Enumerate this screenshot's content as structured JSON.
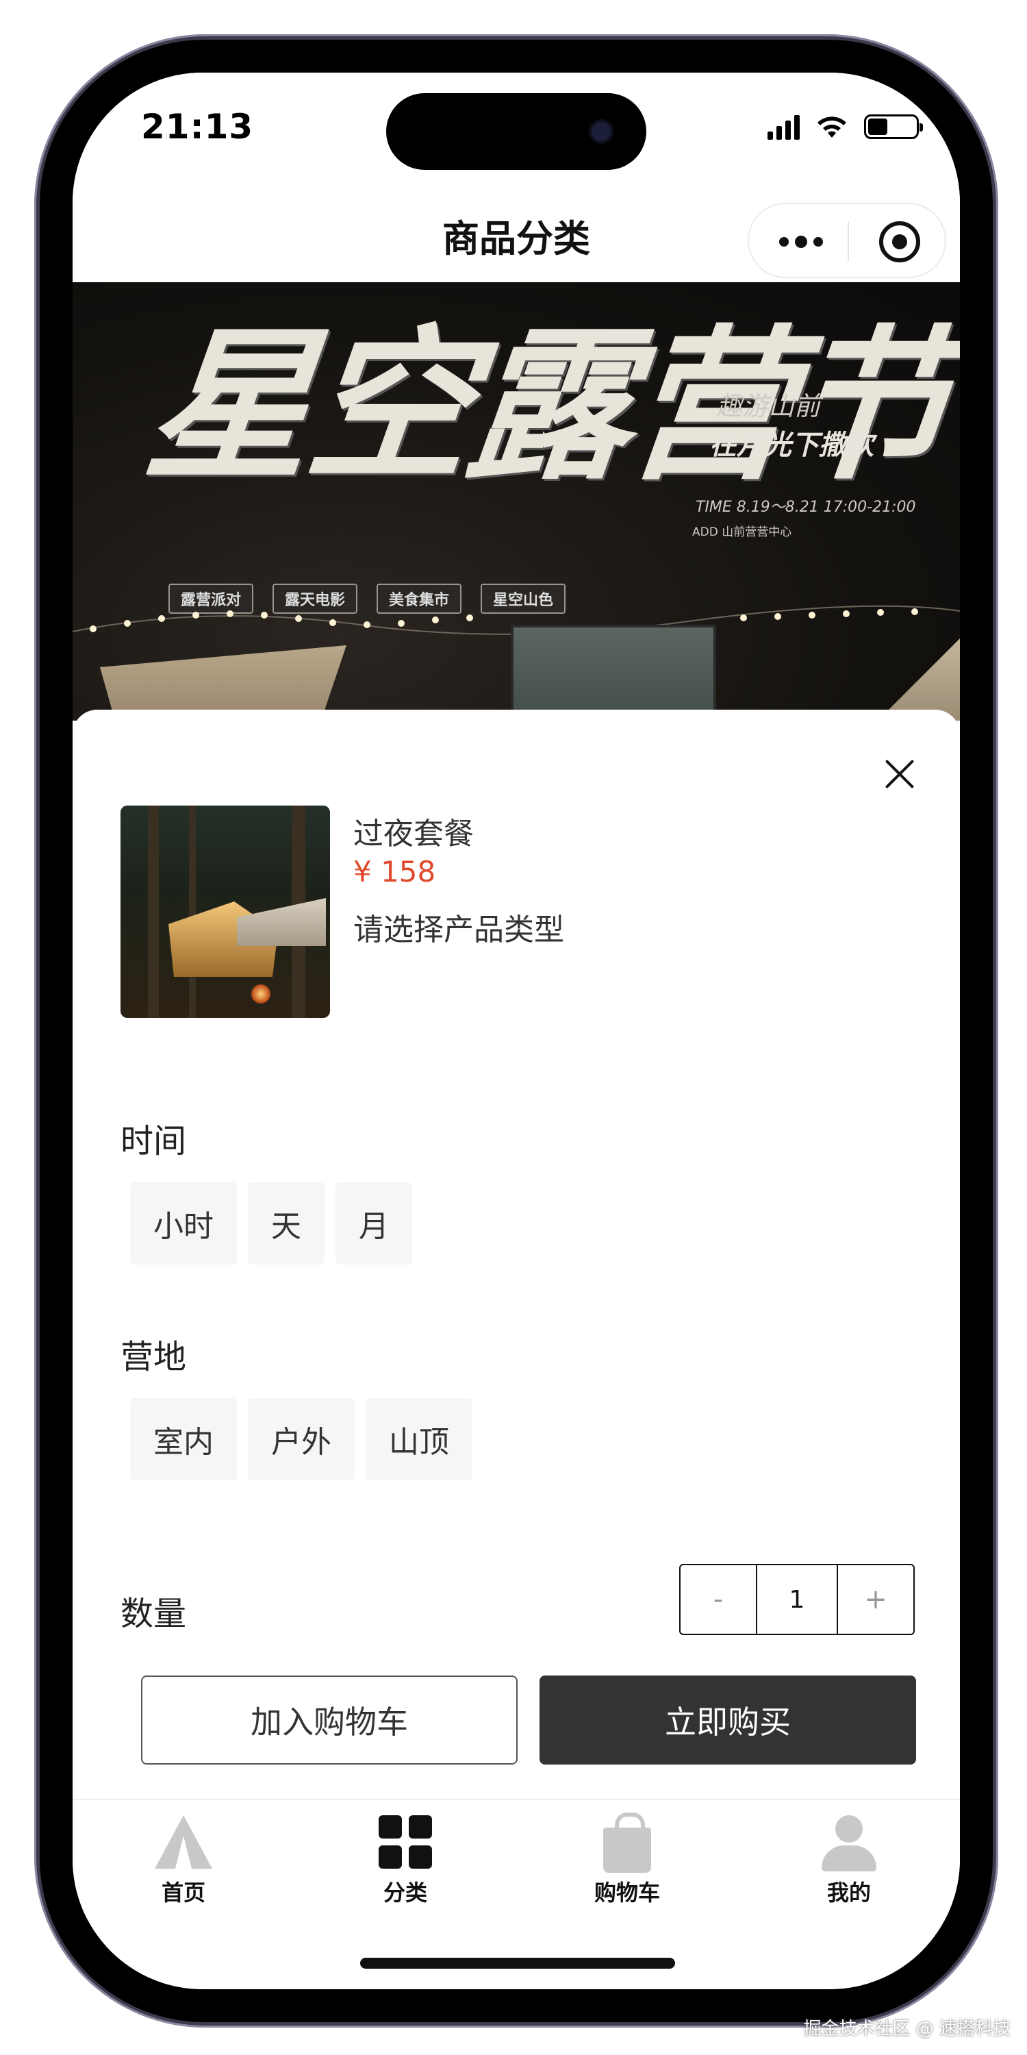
{
  "status_bar": {
    "time": "21:13"
  },
  "nav": {
    "title": "商品分类"
  },
  "banner": {
    "title": "星空露营节",
    "tags": [
      "露营派对",
      "露天电影",
      "美食集市",
      "星空山色"
    ],
    "subtitle_line1": "趣游山前",
    "subtitle_line2": "在月光下撒欢",
    "time_line": "TIME 8.19～8.21  17:00-21:00",
    "address_line": "ADD 山前营营中心"
  },
  "product": {
    "name": "过夜套餐",
    "price": "¥ 158",
    "hint": "请选择产品类型"
  },
  "sections": {
    "time_label": "时间",
    "time_options": [
      "小时",
      "天",
      "月"
    ],
    "site_label": "营地",
    "site_options": [
      "室内",
      "户外",
      "山顶"
    ],
    "quantity_label": "数量"
  },
  "stepper": {
    "minus": "-",
    "value": "1",
    "plus": "+"
  },
  "actions": {
    "add_to_cart": "加入购物车",
    "buy_now": "立即购买"
  },
  "tabs": [
    {
      "label": "首页",
      "icon": "tent-icon"
    },
    {
      "label": "分类",
      "icon": "grid-icon",
      "active": true
    },
    {
      "label": "购物车",
      "icon": "bag-icon"
    },
    {
      "label": "我的",
      "icon": "user-icon"
    }
  ],
  "watermark": "掘金技术社区 @ 速搭科技",
  "colors": {
    "price": "#e04a2b",
    "buy_button": "#333333",
    "inactive_icon": "#c8c8c8"
  }
}
